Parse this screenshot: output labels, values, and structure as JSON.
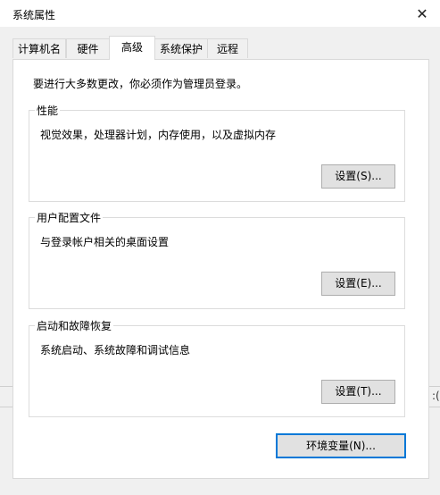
{
  "window": {
    "title": "系统属性",
    "close_glyph": "✕"
  },
  "tabs": [
    {
      "label": "计算机名",
      "active": false
    },
    {
      "label": "硬件",
      "active": false
    },
    {
      "label": "高级",
      "active": true
    },
    {
      "label": "系统保护",
      "active": false
    },
    {
      "label": "远程",
      "active": false
    }
  ],
  "advanced": {
    "admin_note": "要进行大多数更改，你必须作为管理员登录。",
    "performance": {
      "title": "性能",
      "description": "视觉效果，处理器计划，内存使用，以及虚拟内存",
      "button": "设置(S)..."
    },
    "user_profiles": {
      "title": "用户配置文件",
      "description": "与登录帐户相关的桌面设置",
      "button": "设置(E)..."
    },
    "startup_recovery": {
      "title": "启动和故障恢复",
      "description": "系统启动、系统故障和调试信息",
      "button": "设置(T)..."
    },
    "env_button": "环境变量(N)..."
  },
  "background": {
    "edge_text": ":("
  }
}
